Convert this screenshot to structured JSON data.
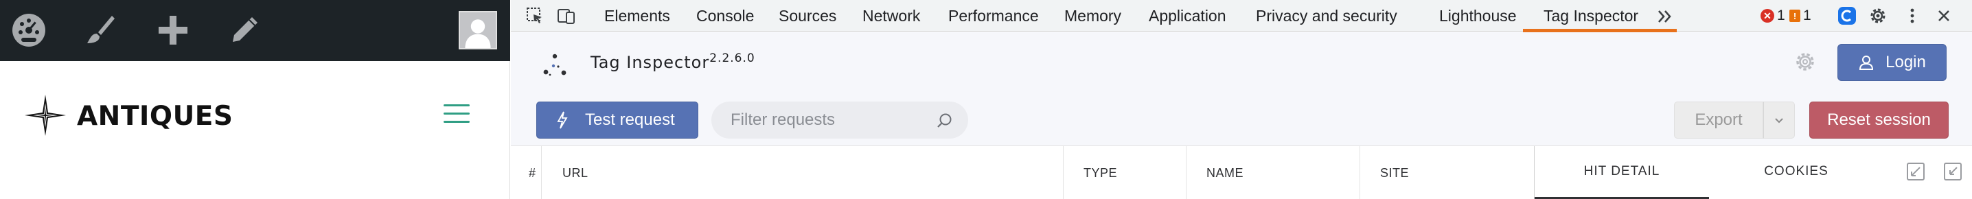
{
  "wordpress": {
    "brand_name": "ANTIQUES",
    "admin_bar_icons": [
      "dashboard-icon",
      "customize-brush-icon",
      "new-plus-icon",
      "edit-pencil-icon",
      "avatar"
    ]
  },
  "devtools": {
    "tabs": [
      {
        "label": "Elements"
      },
      {
        "label": "Console"
      },
      {
        "label": "Sources"
      },
      {
        "label": "Network"
      },
      {
        "label": "Performance"
      },
      {
        "label": "Memory"
      },
      {
        "label": "Application"
      },
      {
        "label": "Privacy and security"
      },
      {
        "label": "Lighthouse"
      },
      {
        "label": "Tag Inspector"
      }
    ],
    "active_tab": "Tag Inspector",
    "error_count": "1",
    "warning_count": "1",
    "colors": {
      "active_underline": "#e8711c",
      "error": "#d93025",
      "warning": "#e8710a",
      "extension": "#1a73e8"
    }
  },
  "tag_inspector": {
    "title": "Tag Inspector",
    "version": "2.2.6.0",
    "login_label": "Login",
    "test_request_label": "Test request",
    "filter_placeholder": "Filter requests",
    "filter_value": "",
    "export_label": "Export",
    "reset_label": "Reset session",
    "columns": [
      "#",
      "URL",
      "TYPE",
      "NAME",
      "SITE"
    ],
    "detail_tabs": [
      "HIT DETAIL",
      "COOKIES"
    ],
    "active_detail_tab": "HIT DETAIL",
    "colors": {
      "primary": "#5672b4",
      "danger": "#bd5b66"
    }
  }
}
